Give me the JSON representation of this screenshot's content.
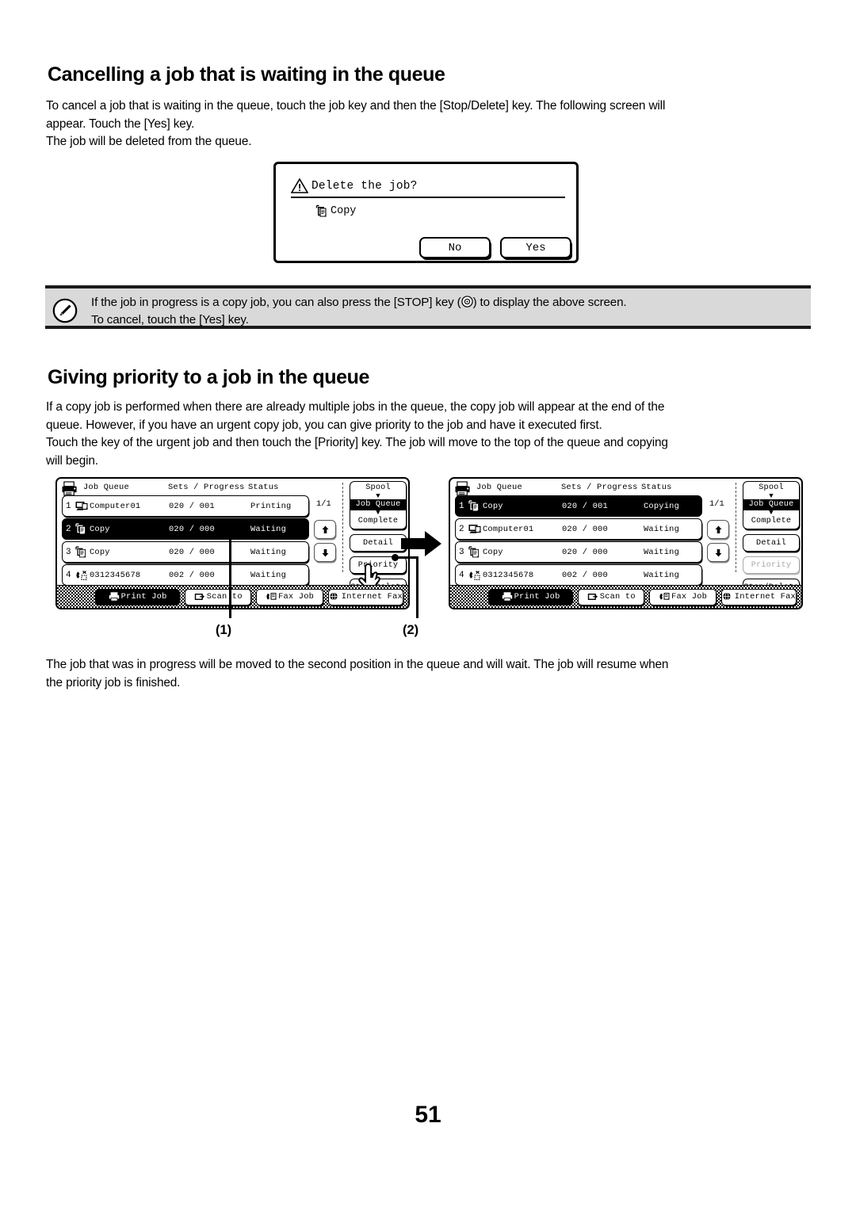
{
  "page": {
    "number": "51"
  },
  "section1": {
    "title": "Cancelling a job that is waiting in the queue",
    "para_line1": "To cancel a job that is waiting in the queue, touch the job key and then the [Stop/Delete] key. The following screen will",
    "para_line2": "appear. Touch the [Yes] key.",
    "para_line3": "The job will be deleted from the queue."
  },
  "dialog": {
    "icon": "warning-triangle-icon",
    "title": "Delete the job?",
    "job_icon": "copy-document-icon",
    "job_label": "Copy",
    "no_label": "No",
    "yes_label": "Yes"
  },
  "note": {
    "icon": "pencil-note-icon",
    "line1_before": "If the job in progress is a copy job, you can also press the [STOP] key (",
    "line1_icon": "stop-key-icon",
    "line1_after": ") to display the above screen.",
    "line2": "To cancel, touch the [Yes] key."
  },
  "section2": {
    "title": "Giving priority to a job in the queue",
    "para_line1": "If a copy job is performed when there are already multiple jobs in the queue, the copy job will appear at the end of the",
    "para_line2": "queue. However, if you have an urgent copy job, you can give priority to the job and have it executed first.",
    "para_line3": "Touch the key of the urgent job and then touch the [Priority] key. The job will move to the top of the queue and copying",
    "para_line4": "will begin."
  },
  "closing": {
    "line1": "The job that was in progress will be moved to the second position in the queue and will wait. The job will resume when",
    "line2": "the priority job is finished."
  },
  "callouts": {
    "one": "(1)",
    "two": "(2)"
  },
  "screens": [
    {
      "title_icon": "printer-icon",
      "headers": {
        "queue": "Job Queue",
        "sets": "Sets / Progress",
        "status": "Status"
      },
      "page_indicator": "1/1",
      "rows": [
        {
          "num": "1",
          "icon": "computer-icon",
          "name": "Computer01",
          "sets": "020 / 001",
          "status": "Printing",
          "selected": false
        },
        {
          "num": "2",
          "icon": "copy-document-icon",
          "name": "Copy",
          "sets": "020 / 000",
          "status": "Waiting",
          "selected": true
        },
        {
          "num": "3",
          "icon": "copy-document-icon",
          "name": "Copy",
          "sets": "020 / 000",
          "status": "Waiting",
          "selected": false
        },
        {
          "num": "4",
          "icon": "fax-phone-icon",
          "name": "0312345678",
          "sets": "002 / 000",
          "status": "Waiting",
          "selected": false
        }
      ],
      "arrow_up_icon": "arrow-up-icon",
      "arrow_down_icon": "arrow-down-icon",
      "mode_switch": {
        "spool": "Spool",
        "job_queue": "Job Queue",
        "complete": "Complete",
        "active": "Job Queue"
      },
      "buttons": {
        "detail": "Detail",
        "priority": "Priority",
        "priority_disabled": false,
        "stop_delete": "Stop/Delete"
      },
      "tabs": [
        {
          "label": "Print Job",
          "icon": "print-job-icon",
          "selected": true
        },
        {
          "label": "Scan to",
          "icon": "scan-to-icon",
          "selected": false
        },
        {
          "label": "Fax Job",
          "icon": "fax-job-icon",
          "selected": false
        },
        {
          "label": "Internet Fax",
          "icon": "internet-fax-icon",
          "selected": false
        }
      ],
      "has_hand_cursor": true
    },
    {
      "title_icon": "printer-icon",
      "headers": {
        "queue": "Job Queue",
        "sets": "Sets / Progress",
        "status": "Status"
      },
      "page_indicator": "1/1",
      "rows": [
        {
          "num": "1",
          "icon": "copy-document-icon",
          "name": "Copy",
          "sets": "020 / 001",
          "status": "Copying",
          "selected": true
        },
        {
          "num": "2",
          "icon": "computer-icon",
          "name": "Computer01",
          "sets": "020 / 000",
          "status": "Waiting",
          "selected": false
        },
        {
          "num": "3",
          "icon": "copy-document-icon",
          "name": "Copy",
          "sets": "020 / 000",
          "status": "Waiting",
          "selected": false
        },
        {
          "num": "4",
          "icon": "fax-phone-icon",
          "name": "0312345678",
          "sets": "002 / 000",
          "status": "Waiting",
          "selected": false
        }
      ],
      "arrow_up_icon": "arrow-up-icon",
      "arrow_down_icon": "arrow-down-icon",
      "mode_switch": {
        "spool": "Spool",
        "job_queue": "Job Queue",
        "complete": "Complete",
        "active": "Job Queue"
      },
      "buttons": {
        "detail": "Detail",
        "priority": "Priority",
        "priority_disabled": true,
        "stop_delete": "Stop/Delete"
      },
      "tabs": [
        {
          "label": "Print Job",
          "icon": "print-job-icon",
          "selected": true
        },
        {
          "label": "Scan to",
          "icon": "scan-to-icon",
          "selected": false
        },
        {
          "label": "Fax Job",
          "icon": "fax-job-icon",
          "selected": false
        },
        {
          "label": "Internet Fax",
          "icon": "internet-fax-icon",
          "selected": false
        }
      ],
      "has_hand_cursor": false
    }
  ],
  "colors": {
    "note_bg": "#d9d9d9",
    "ink": "#000000",
    "disabled": "#a8a8a8"
  }
}
